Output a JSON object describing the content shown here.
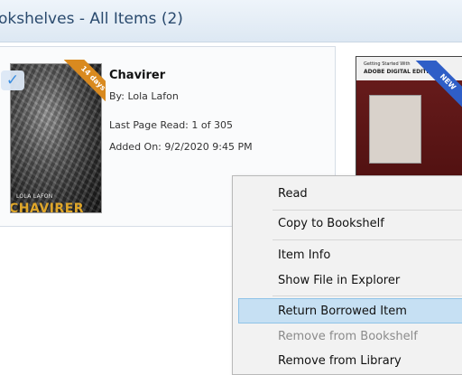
{
  "header": {
    "title": "okshelves - All Items (2)"
  },
  "book1": {
    "badge": "14 days",
    "title": "Chavirer",
    "author": "By:  Lola Lafon",
    "last_page": "Last Page Read:  1 of 305",
    "added": "Added On:  9/2/2020 9:45 PM",
    "cover_author": "LOLA LAFON",
    "cover_title": "CHAVIRER"
  },
  "book2": {
    "badge": "NEW",
    "cover_line1": "Getting Started With",
    "cover_line2": "ADOBE DIGITAL EDITIONS"
  },
  "context_menu": {
    "items": [
      {
        "label": "Read",
        "state": "normal"
      },
      {
        "label": "Copy to Bookshelf",
        "state": "normal"
      },
      {
        "label": "Item Info",
        "state": "normal"
      },
      {
        "label": "Show File in Explorer",
        "state": "normal"
      },
      {
        "label": "Return Borrowed Item",
        "state": "highlighted"
      },
      {
        "label": "Remove from Bookshelf",
        "state": "disabled"
      },
      {
        "label": "Remove from Library",
        "state": "normal"
      }
    ]
  },
  "colors": {
    "accent": "#3b8ee0",
    "badge_borrowed": "#d98a1f",
    "badge_new": "#2f5ec7",
    "menu_highlight": "#c6e0f3"
  }
}
